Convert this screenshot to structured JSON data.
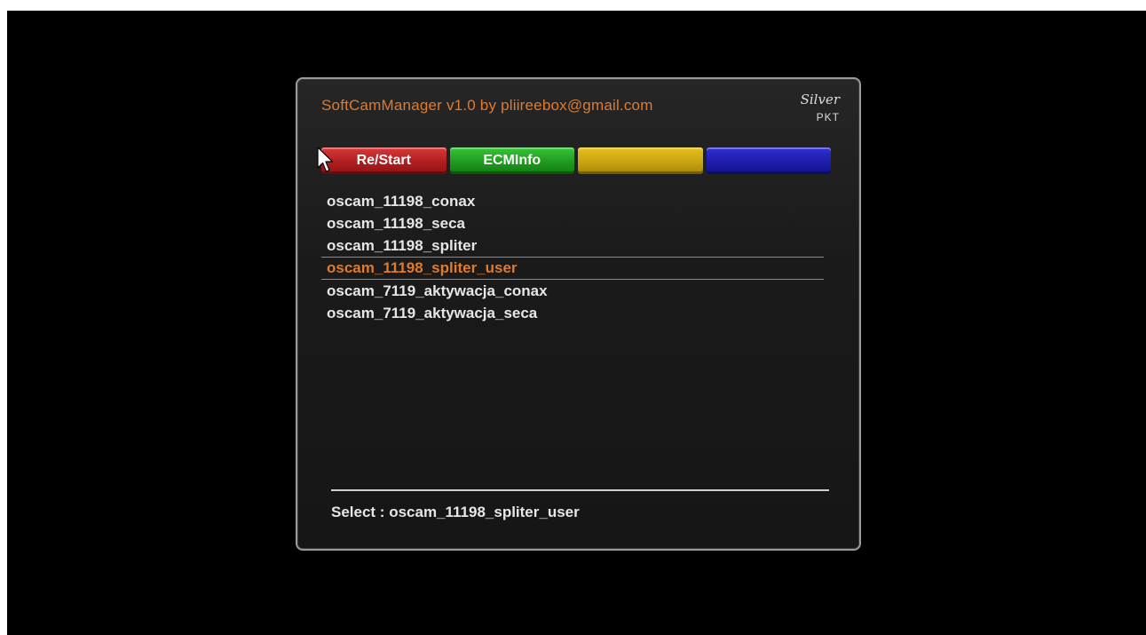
{
  "app": {
    "title": "SoftCamManager v1.0 by pliireebox@gmail.com",
    "logo_script": "Silver",
    "logo_sub": "PKT"
  },
  "colors": {
    "accent": "#e07a2c",
    "red": "#b01e1e",
    "green": "#1f9a1f",
    "yellow": "#c9a412",
    "blue": "#1d1dab"
  },
  "color_buttons": [
    {
      "label": "Re/Start",
      "color": "red"
    },
    {
      "label": "ECMInfo",
      "color": "green"
    },
    {
      "label": "",
      "color": "yellow"
    },
    {
      "label": "",
      "color": "blue"
    }
  ],
  "softcams": [
    "oscam_11198_conax",
    "oscam_11198_seca",
    "oscam_11198_spliter",
    "oscam_11198_spliter_user",
    "oscam_7119_aktywacja_conax",
    "oscam_7119_aktywacja_seca"
  ],
  "selected_index": 3,
  "status": {
    "text": "Select : oscam_11198_spliter_user"
  }
}
